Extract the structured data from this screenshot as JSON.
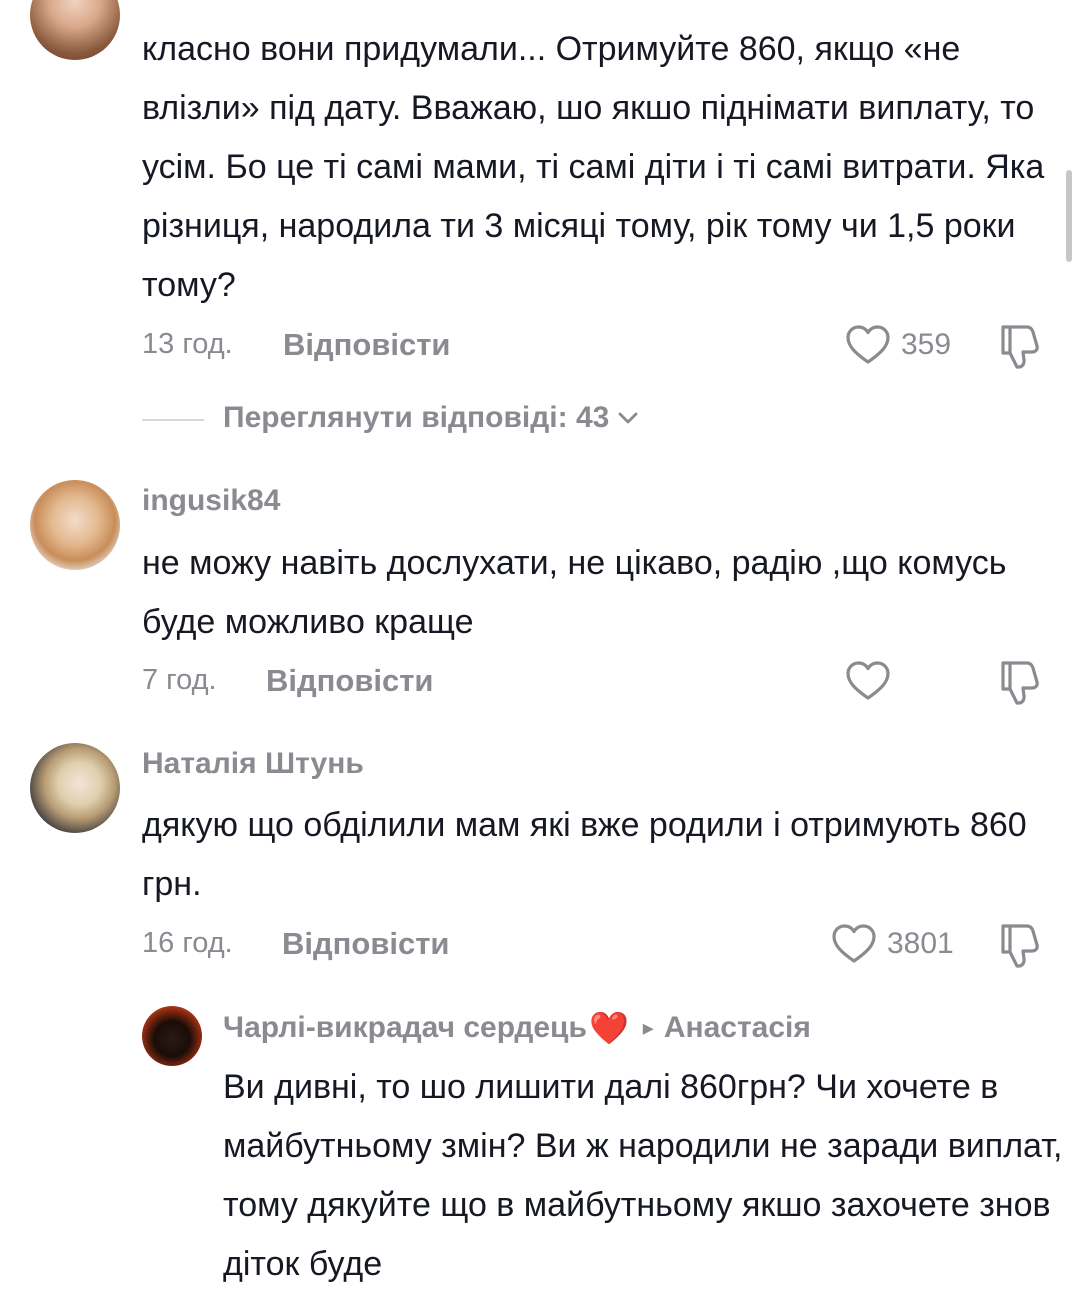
{
  "comments": [
    {
      "text": "класно вони придумали... Отримуйте 860, якщо «не влізли» під дату. Вважаю, шо якшо піднімати виплату, то усім. Бо це ті самі мами, ті самі діти і ті самі витрати. Яка різниця, народила ти 3 місяці тому, рік тому чи 1,5 роки тому?",
      "time": "13 год.",
      "reply_label": "Відповісти",
      "likes": "359",
      "view_replies": "Переглянути відповіді: 43"
    },
    {
      "username": "ingusik84",
      "text": "не можу навіть дослухати, не цікаво, радію ,що комусь буде можливо краще",
      "time": "7 год.",
      "reply_label": "Відповісти"
    },
    {
      "username": "Наталія Штунь",
      "text": "дякую що обділили мам які вже родили і отримують 860 грн.",
      "time": "16 год.",
      "reply_label": "Відповісти",
      "likes": "3801"
    }
  ],
  "reply": {
    "username": "Чарлі-викрадач сердець",
    "heart": "❤️",
    "arrow": "▸",
    "reply_to": "Анастасія",
    "text": "Ви дивні, то шо лишити далі 860грн? Чи хочете в майбутньому змін? Ви ж народили не заради виплат, тому дякуйте що в майбутньому якшо захочете знов діток буде"
  },
  "icons": {
    "like": "heart-outline-icon",
    "dislike": "thumbs-down-icon",
    "chevron": "chevron-down-icon"
  },
  "colors": {
    "text": "#161823",
    "muted": "#8a8b91",
    "heart": "#e0245e"
  }
}
